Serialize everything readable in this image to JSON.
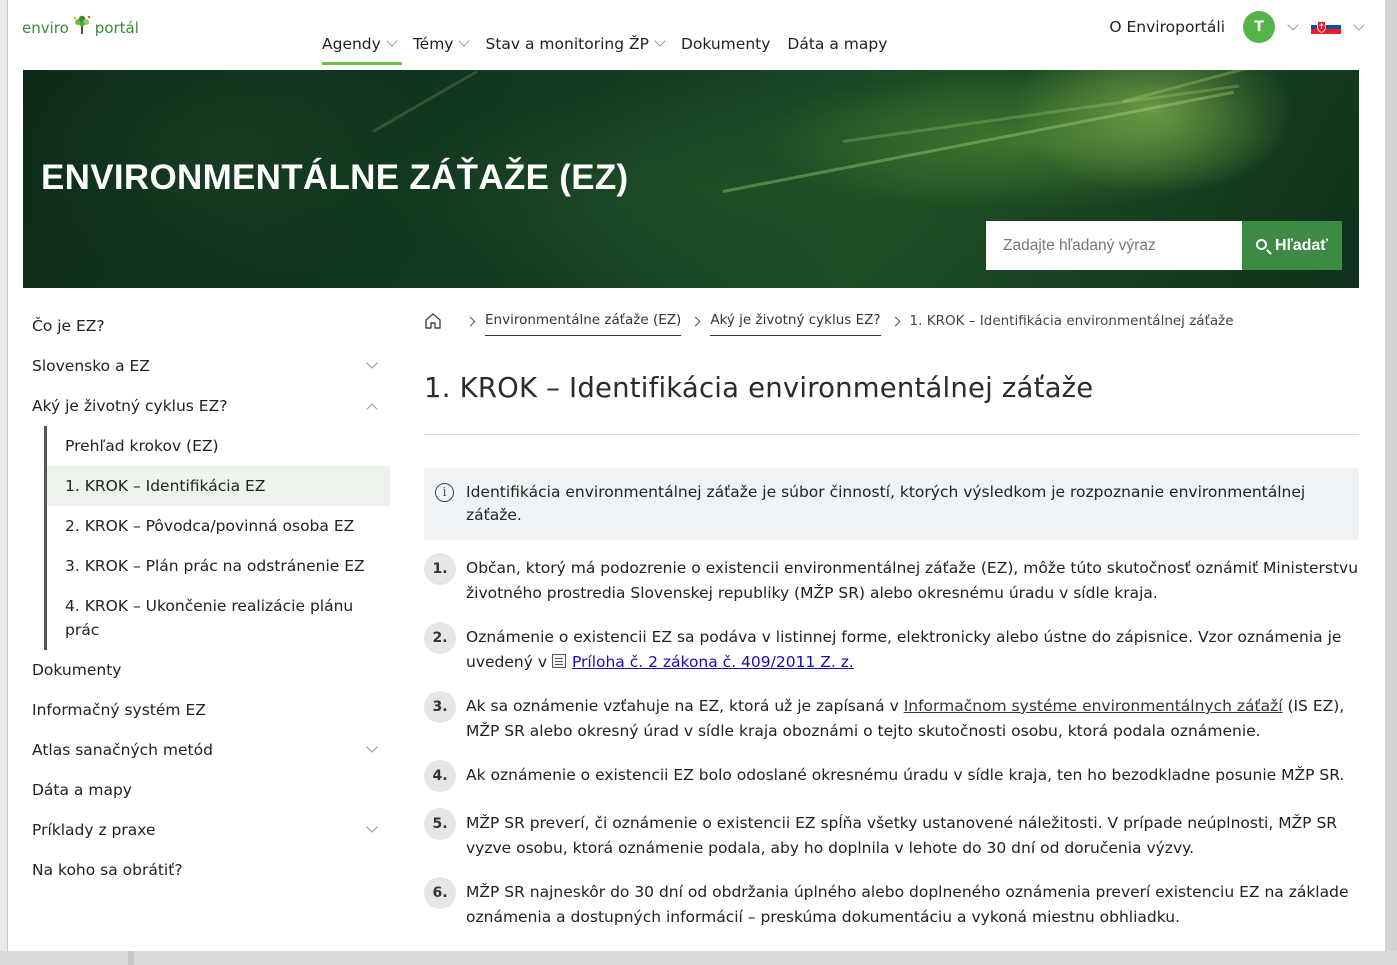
{
  "header": {
    "logo": {
      "part1": "enviro",
      "part2": "portál"
    },
    "nav": [
      {
        "label": "Agendy",
        "has_dropdown": true,
        "active": true
      },
      {
        "label": "Témy",
        "has_dropdown": true
      },
      {
        "label": "Stav a monitoring ŽP",
        "has_dropdown": true
      },
      {
        "label": "Dokumenty",
        "has_dropdown": false
      },
      {
        "label": "Dáta a mapy",
        "has_dropdown": false
      }
    ],
    "about_label": "O Enviroportáli",
    "avatar_initial": "T",
    "accent_color": "#6cbf4a"
  },
  "hero": {
    "title": "ENVIRONMENTÁLNE ZÁŤAŽE (EZ)",
    "search_placeholder": "Zadajte hľadaný výraz",
    "search_button": "Hľadať"
  },
  "sidebar": {
    "items_top": [
      {
        "label": "Čo je EZ?",
        "chevron": "none"
      },
      {
        "label": "Slovensko a EZ",
        "chevron": "down"
      },
      {
        "label": "Aký je životný cyklus EZ?",
        "chevron": "up"
      }
    ],
    "sub_items": [
      {
        "label": "Prehľad krokov (EZ)",
        "active": false
      },
      {
        "label": "1. KROK – Identifikácia EZ",
        "active": true
      },
      {
        "label": "2. KROK – Pôvodca/povinná osoba EZ",
        "active": false
      },
      {
        "label": "3. KROK – Plán prác na odstránenie EZ",
        "active": false
      },
      {
        "label": "4. KROK – Ukončenie realizácie plánu prác",
        "active": false
      }
    ],
    "items_bottom": [
      {
        "label": "Dokumenty",
        "chevron": "none"
      },
      {
        "label": "Informačný systém EZ",
        "chevron": "none"
      },
      {
        "label": "Atlas sanačných metód",
        "chevron": "down"
      },
      {
        "label": "Dáta a mapy",
        "chevron": "none"
      },
      {
        "label": "Príklady z praxe",
        "chevron": "down"
      },
      {
        "label": "Na koho sa obrátiť?",
        "chevron": "none"
      }
    ]
  },
  "breadcrumb": {
    "links": [
      "Environmentálne záťaže (EZ)",
      "Aký je životný cyklus EZ?"
    ],
    "current": "1. KROK – Identifikácia environmentálnej záťaže"
  },
  "main": {
    "title": "1. KROK – Identifikácia environmentálnej záťaže",
    "info": "Identifikácia environmentálnej záťaže je súbor činností, ktorých výsledkom je rozpoznanie environmentálnej záťaže.",
    "steps": [
      {
        "num": "1.",
        "text": "Občan, ktorý má podozrenie o existencii environmentálnej záťaže (EZ), môže túto skutočnosť oznámiť Ministerstvu životného prostredia Slovenskej republiky (MŽP SR) alebo okresnému úradu v sídle kraja."
      },
      {
        "num": "2.",
        "text_before": "Oznámenie o existencii EZ sa podáva v listinnej forme, elektronicky alebo ústne do zápisnice. Vzor oznámenia je uvedený v ",
        "link": "Príloha č. 2 zákona č. 409/2011 Z. z."
      },
      {
        "num": "3.",
        "text_before": "Ak sa oznámenie vzťahuje na EZ, ktorá už je zapísaná v ",
        "link": "Informačnom systéme environmentálnych záťaží",
        "text_after": " (IS EZ), MŽP SR alebo okresný úrad v sídle kraja oboznámi o tejto skutočnosti osobu, ktorá podala oznámenie."
      },
      {
        "num": "4.",
        "text": "Ak oznámenie o existencii EZ bolo odoslané okresnému úradu v sídle kraja, ten ho bezodkladne posunie MŽP SR."
      },
      {
        "num": "5.",
        "text": "MŽP SR preverí, či oznámenie o existencii EZ spĺňa všetky ustanovené náležitosti. V prípade neúplnosti, MŽP SR vyzve osobu, ktorá oznámenie podala, aby ho doplnila v lehote do 30 dní od doručenia výzvy."
      },
      {
        "num": "6.",
        "text": "MŽP SR najneskôr do 30 dní od obdržania úplného alebo doplneného oznámenia preverí existenciu EZ na základe oznámenia a dostupných informácií – preskúma dokumentáciu a vykoná miestnu obhliadku."
      }
    ]
  }
}
